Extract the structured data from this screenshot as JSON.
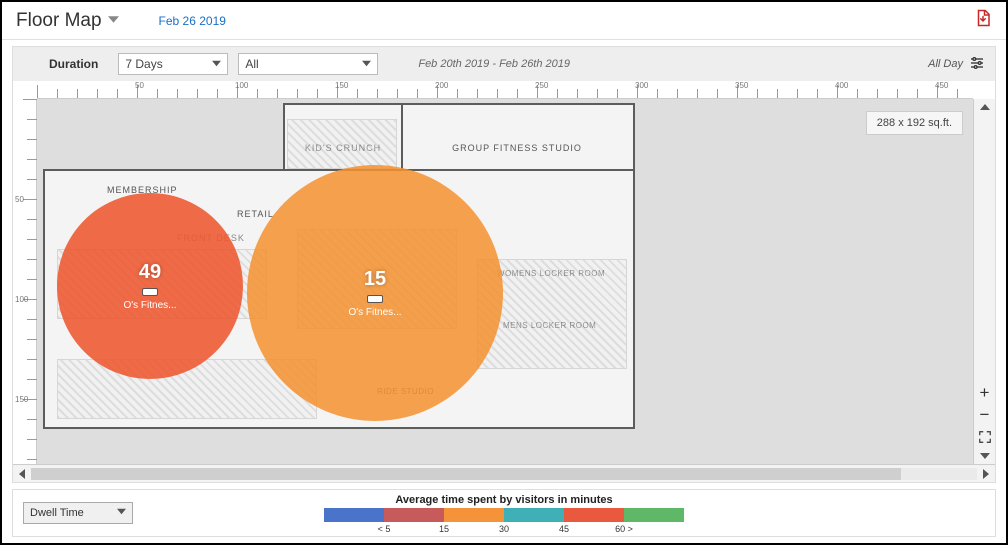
{
  "header": {
    "title": "Floor Map",
    "date_link": "Feb 26 2019"
  },
  "filters": {
    "duration_label": "Duration",
    "duration_value": "7 Days",
    "scope_value": "All",
    "range_text": "Feb 20th 2019 - Feb 26th 2019",
    "allday_label": "All Day"
  },
  "map": {
    "dimensions_badge": "288 x 192 sq.ft.",
    "ruler_h_labels": [
      "50",
      "100",
      "150",
      "200",
      "250",
      "300",
      "350",
      "400",
      "450"
    ],
    "ruler_v_labels": [
      "50",
      "100",
      "150"
    ],
    "rooms": {
      "kids": "KID'S\nCRUNCH",
      "group": "GROUP FITNESS\nSTUDIO",
      "membership": "MEMBERSHIP",
      "retail": "RETAIL",
      "frontdesk": "FRONT DESK",
      "womens": "WOMENS LOCKER ROOM",
      "mens": "MENS LOCKER ROOM",
      "ride": "RIDE\nSTUDIO"
    },
    "bubbles": [
      {
        "value": "49",
        "label": "O's Fitnes..."
      },
      {
        "value": "15",
        "label": "O's Fitnes..."
      }
    ]
  },
  "footer": {
    "dropdown_value": "Dwell Time",
    "legend_title": "Average time spent by visitors in minutes",
    "legend_ticks": [
      "< 5",
      "15",
      "30",
      "45",
      "60 >"
    ]
  }
}
